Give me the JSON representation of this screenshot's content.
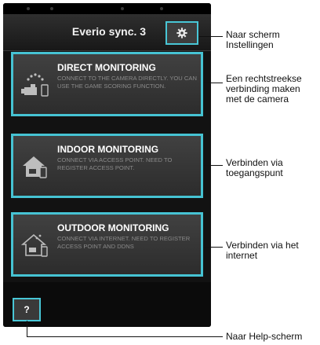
{
  "app": {
    "title": "Everio sync. 3"
  },
  "cards": [
    {
      "title": "DIRECT MONITORING",
      "description": "CONNECT TO THE CAMERA DIRECTLY. YOU CAN USE THE GAME SCORING FUNCTION.",
      "icon": "camera-phone-icon"
    },
    {
      "title": "INDOOR MONITORING",
      "description": "CONNECT VIA ACCESS POINT. NEED TO REGISTER ACCESS POINT.",
      "icon": "house-icon"
    },
    {
      "title": "OUTDOOR MONITORING",
      "description": "CONNECT VIA INTERNET. NEED TO REGISTER ACCESS POINT AND DDNS",
      "icon": "house-internet-icon"
    }
  ],
  "help_label": "?",
  "settings_icon": "gear-icon",
  "annotations": {
    "settings": [
      "Naar scherm",
      "Instellingen"
    ],
    "direct": [
      "Een rechtstreekse",
      "verbinding maken",
      "met de camera"
    ],
    "indoor": [
      "Verbinden via",
      "toegangspunt"
    ],
    "outdoor": [
      "Verbinden via het",
      "internet"
    ],
    "help": [
      "Naar Help-scherm"
    ]
  },
  "colors": {
    "accent": "#46c3d3",
    "background": "#121212",
    "card": "#3a3a3a"
  }
}
